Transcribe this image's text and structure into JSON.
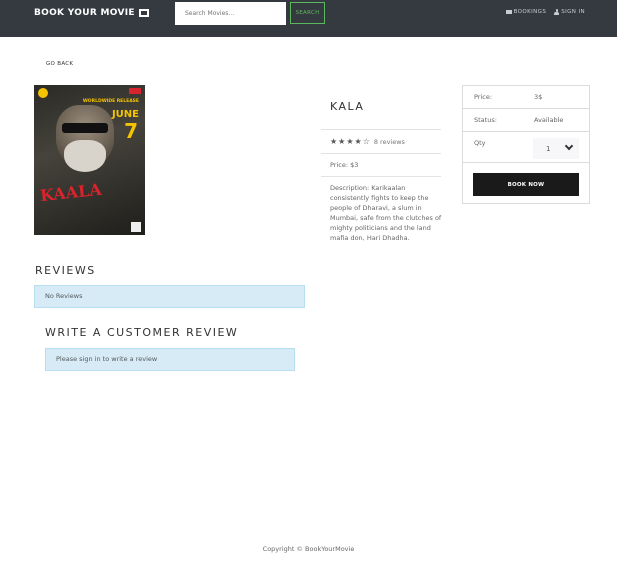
{
  "navbar": {
    "brand": "BOOK YOUR MOVIE",
    "brand_icon": "film-icon",
    "search_placeholder": "Search Movies...",
    "search_button": "SEARCH",
    "bookings": "BOOKINGS",
    "sign_in": "SIGN IN",
    "accent_color": "#5cb85c",
    "background": "#343a40"
  },
  "go_back": "GO BACK",
  "poster": {
    "release_line": "WORLDWIDE RELEASE",
    "month": "JUNE",
    "day": "7",
    "title_art": "KAALA"
  },
  "movie": {
    "title": "KALA",
    "rating_value": 4,
    "rating_max": 5,
    "reviews_count": "8 reviews",
    "price": "Price: $3",
    "description": "Description: Karikaalan consistently fights to keep the people of Dharavi, a slum in Mumbai, safe from the clutches of mighty politicians and the land mafia don, Hari Dhadha."
  },
  "buy_card": {
    "price_label": "Price:",
    "price_value": "3$",
    "status_label": "Status:",
    "status_value": "Available",
    "qty_label": "Qty",
    "qty_value": "1",
    "book_button": "BOOK NOW"
  },
  "reviews": {
    "heading": "REVIEWS",
    "empty_message": "No Reviews",
    "write_heading": "WRITE A CUSTOMER REVIEW",
    "signin_message": "Please sign in to write a review"
  },
  "footer": {
    "copyright": "Copyright © BookYourMovie"
  }
}
